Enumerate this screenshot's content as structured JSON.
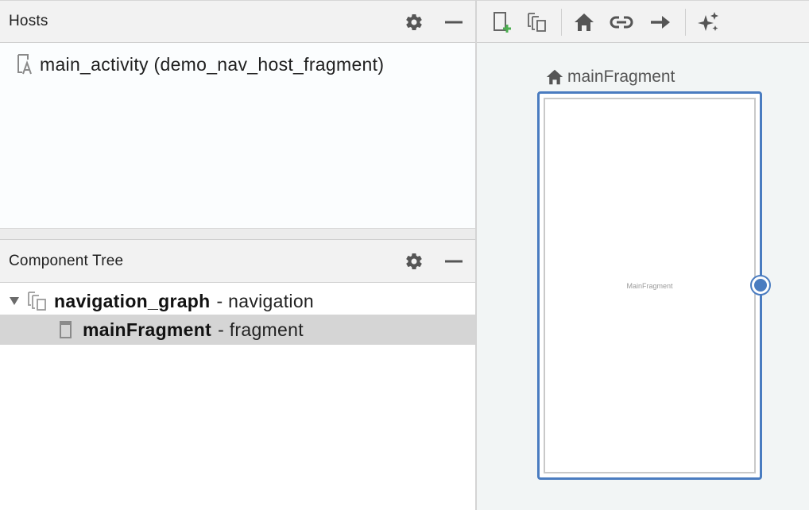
{
  "hosts_panel": {
    "title": "Hosts",
    "settings_icon": "gear-icon",
    "hide_icon": "minus-icon",
    "items": [
      {
        "label": "main_activity (demo_nav_host_fragment)",
        "icon": "layout-file-icon"
      }
    ]
  },
  "component_tree": {
    "title": "Component Tree",
    "settings_icon": "gear-icon",
    "hide_icon": "minus-icon",
    "rows": [
      {
        "name": "navigation_graph",
        "type": "- navigation",
        "expanded": true,
        "icon": "nav-graph-icon"
      },
      {
        "name": "mainFragment",
        "type": "- fragment",
        "selected": true,
        "icon": "fragment-icon"
      }
    ]
  },
  "design_toolbar": {
    "buttons": [
      {
        "name": "new-destination",
        "icon": "new-destination-icon"
      },
      {
        "name": "nested-graph",
        "icon": "nested-graph-icon"
      },
      {
        "name": "assign-start-destination",
        "icon": "home-icon"
      },
      {
        "name": "deep-link",
        "icon": "link-icon"
      },
      {
        "name": "add-action",
        "icon": "arrow-right-icon"
      },
      {
        "name": "auto-arrange",
        "icon": "sparkle-icon"
      }
    ]
  },
  "canvas": {
    "destination_label": "mainFragment",
    "destination_preview_text": "MainFragment",
    "start_icon": "home-icon"
  },
  "colors": {
    "selection": "#d5d5d5",
    "accent": "#4a7cc0",
    "add_green": "#4caf50",
    "canvas_bg": "#f2f5f5",
    "header_bg": "#f2f2f2"
  }
}
